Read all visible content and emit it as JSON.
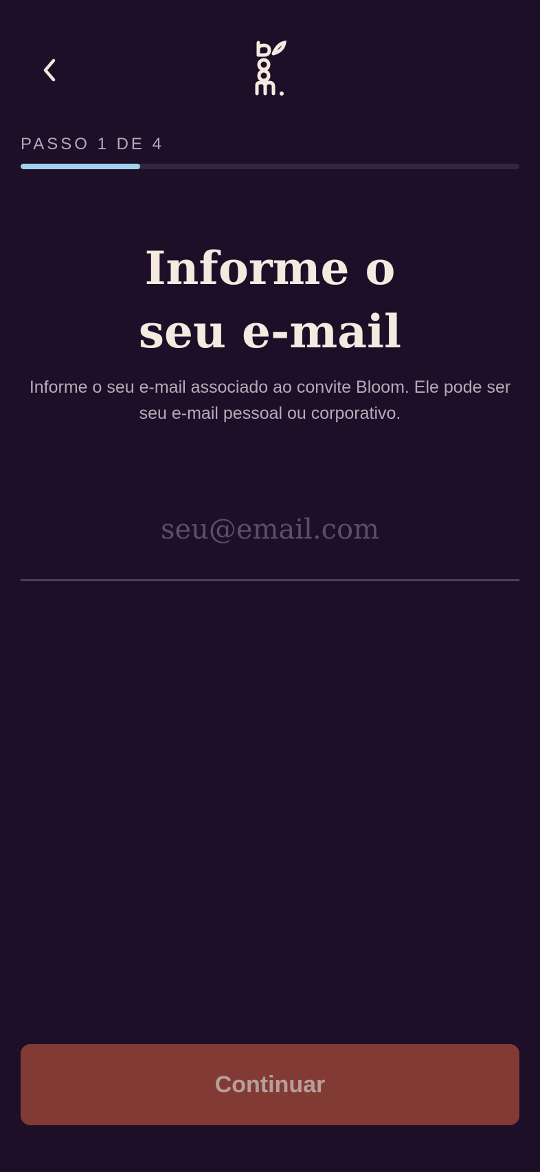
{
  "header": {
    "back_icon": "chevron-left-icon",
    "logo_text": "bloom."
  },
  "progress": {
    "step_label": "PASSO 1 DE 4",
    "current_step": 1,
    "total_steps": 4,
    "fraction": 0.24,
    "track_color": "#352640",
    "fill_color": "#9fd2ec"
  },
  "main": {
    "title_line1": "Informe o",
    "title_line2": "seu e-mail",
    "subtitle": "Informe o seu e-mail associado ao convite Bloom. Ele pode ser seu e-mail pessoal ou corporativo."
  },
  "email": {
    "placeholder": "seu@email.com",
    "value": ""
  },
  "footer": {
    "continue_label": "Continuar",
    "button_color": "#823b34"
  },
  "colors": {
    "background": "#1e0f28",
    "text_primary": "#f6e9df",
    "text_secondary": "#b8a9b9"
  }
}
